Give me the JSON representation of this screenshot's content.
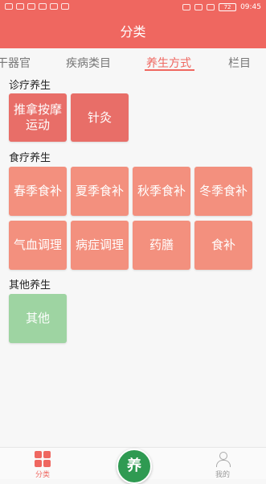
{
  "status_bar": {
    "left_icons": [
      "sim-icon",
      "signal-icon",
      "signal-icon",
      "wifi-icon",
      "notification-icon",
      "notification-icon"
    ],
    "right_icons": [
      "eye-icon",
      "mute-icon",
      "vibrate-icon"
    ],
    "battery": "72",
    "time": "09:45"
  },
  "header": {
    "title": "分类"
  },
  "tabs": [
    "干器官",
    "疾病类目",
    "养生方式",
    "栏目"
  ],
  "sections": [
    {
      "title": "诊疗养生",
      "items": [
        "推拿按摩运动",
        "针灸"
      ]
    },
    {
      "title": "食疗养生",
      "items": [
        "春季食补",
        "夏季食补",
        "秋季食补",
        "冬季食补",
        "气血调理",
        "病症调理",
        "药膳",
        "食补"
      ]
    },
    {
      "title": "其他养生",
      "items": [
        "其他"
      ]
    }
  ],
  "bottom_nav": {
    "left_label": "分类",
    "center_label": "养",
    "right_label": "我的"
  },
  "colors": {
    "accent": "#ef6760",
    "tile_red": "#e86e68",
    "tile_salmon": "#f3907e",
    "tile_green": "#9ed4a2",
    "center_button": "#2f9a52"
  }
}
